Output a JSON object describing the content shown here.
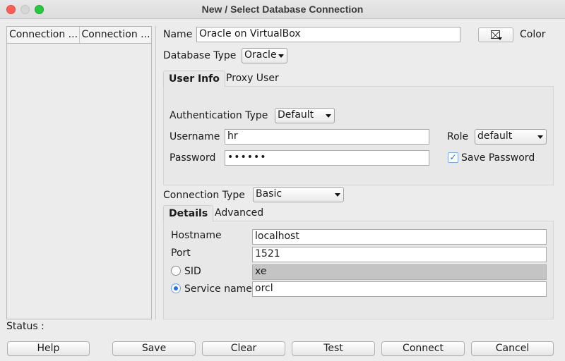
{
  "window": {
    "title": "New / Select Database Connection"
  },
  "connections": {
    "columns": [
      "Connection ...",
      "Connection ..."
    ]
  },
  "form": {
    "name_label": "Name",
    "name_value": "Oracle on VirtualBox",
    "color_label": "Color",
    "db_type_label": "Database Type",
    "db_type_value": "Oracle",
    "tabs": [
      "User Info",
      "Proxy User"
    ],
    "auth_type_label": "Authentication Type",
    "auth_type_value": "Default",
    "username_label": "Username",
    "username_value": "hr",
    "role_label": "Role",
    "role_value": "default",
    "password_label": "Password",
    "password_value": "••••••",
    "save_password_label": "Save Password",
    "save_password_checked": true,
    "conn_type_label": "Connection Type",
    "conn_type_value": "Basic",
    "detail_tabs": [
      "Details",
      "Advanced"
    ],
    "hostname_label": "Hostname",
    "hostname_value": "localhost",
    "port_label": "Port",
    "port_value": "1521",
    "sid_label": "SID",
    "sid_value": "xe",
    "service_label": "Service name",
    "service_value": "orcl"
  },
  "status_label": "Status :",
  "buttons": {
    "help": "Help",
    "save": "Save",
    "clear": "Clear",
    "test": "Test",
    "connect": "Connect",
    "cancel": "Cancel"
  }
}
